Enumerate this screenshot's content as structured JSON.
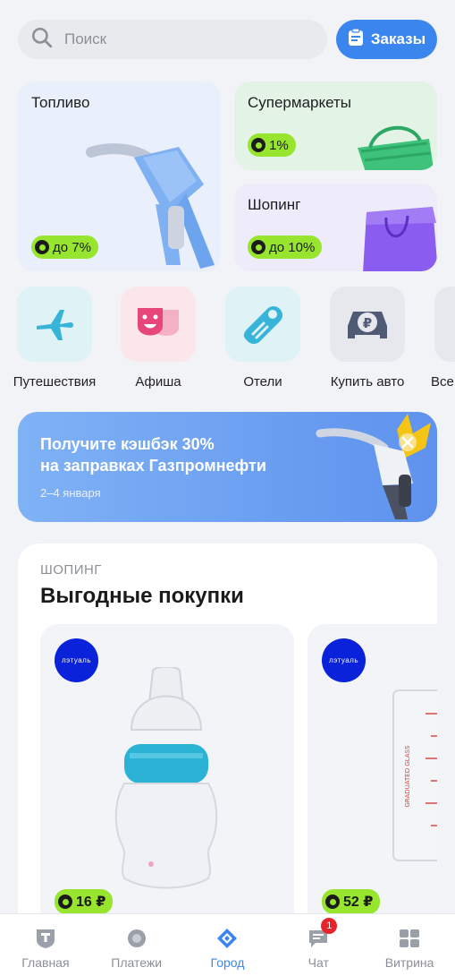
{
  "search": {
    "placeholder": "Поиск"
  },
  "orders": {
    "label": "Заказы"
  },
  "categories": [
    {
      "title": "Топливо",
      "cashback": "до 7%"
    },
    {
      "title": "Супермаркеты",
      "cashback": "1%"
    },
    {
      "title": "Шопинг",
      "cashback": "до 10%"
    }
  ],
  "shortcuts": [
    {
      "label": "Путешествия",
      "icon": "airplane-icon"
    },
    {
      "label": "Афиша",
      "icon": "theater-masks-icon"
    },
    {
      "label": "Отели",
      "icon": "door-hanger-icon"
    },
    {
      "label": "Купить авто",
      "icon": "car-ruble-icon"
    },
    {
      "label": "Все",
      "icon": "more-icon"
    }
  ],
  "promo": {
    "title_line1": "Получите кэшбэк 30%",
    "title_line2": "на заправках Газпромнефти",
    "date": "2–4 января"
  },
  "shopping": {
    "kicker": "ШОПИНГ",
    "title": "Выгодные покупки",
    "products": [
      {
        "brand": "лэтуаль",
        "price": "16 ₽"
      },
      {
        "brand": "лэтуаль",
        "price": "52 ₽"
      }
    ]
  },
  "tabs": [
    {
      "label": "Главная",
      "icon": "home-shield-icon"
    },
    {
      "label": "Платежи",
      "icon": "payments-icon"
    },
    {
      "label": "Город",
      "icon": "city-icon",
      "active": true
    },
    {
      "label": "Чат",
      "icon": "chat-icon",
      "badge": "1"
    },
    {
      "label": "Витрина",
      "icon": "showcase-icon"
    }
  ],
  "colors": {
    "accent": "#3a86ee",
    "cashback": "#98e52f",
    "brand": "#0a22d9",
    "alert": "#e8232b"
  }
}
